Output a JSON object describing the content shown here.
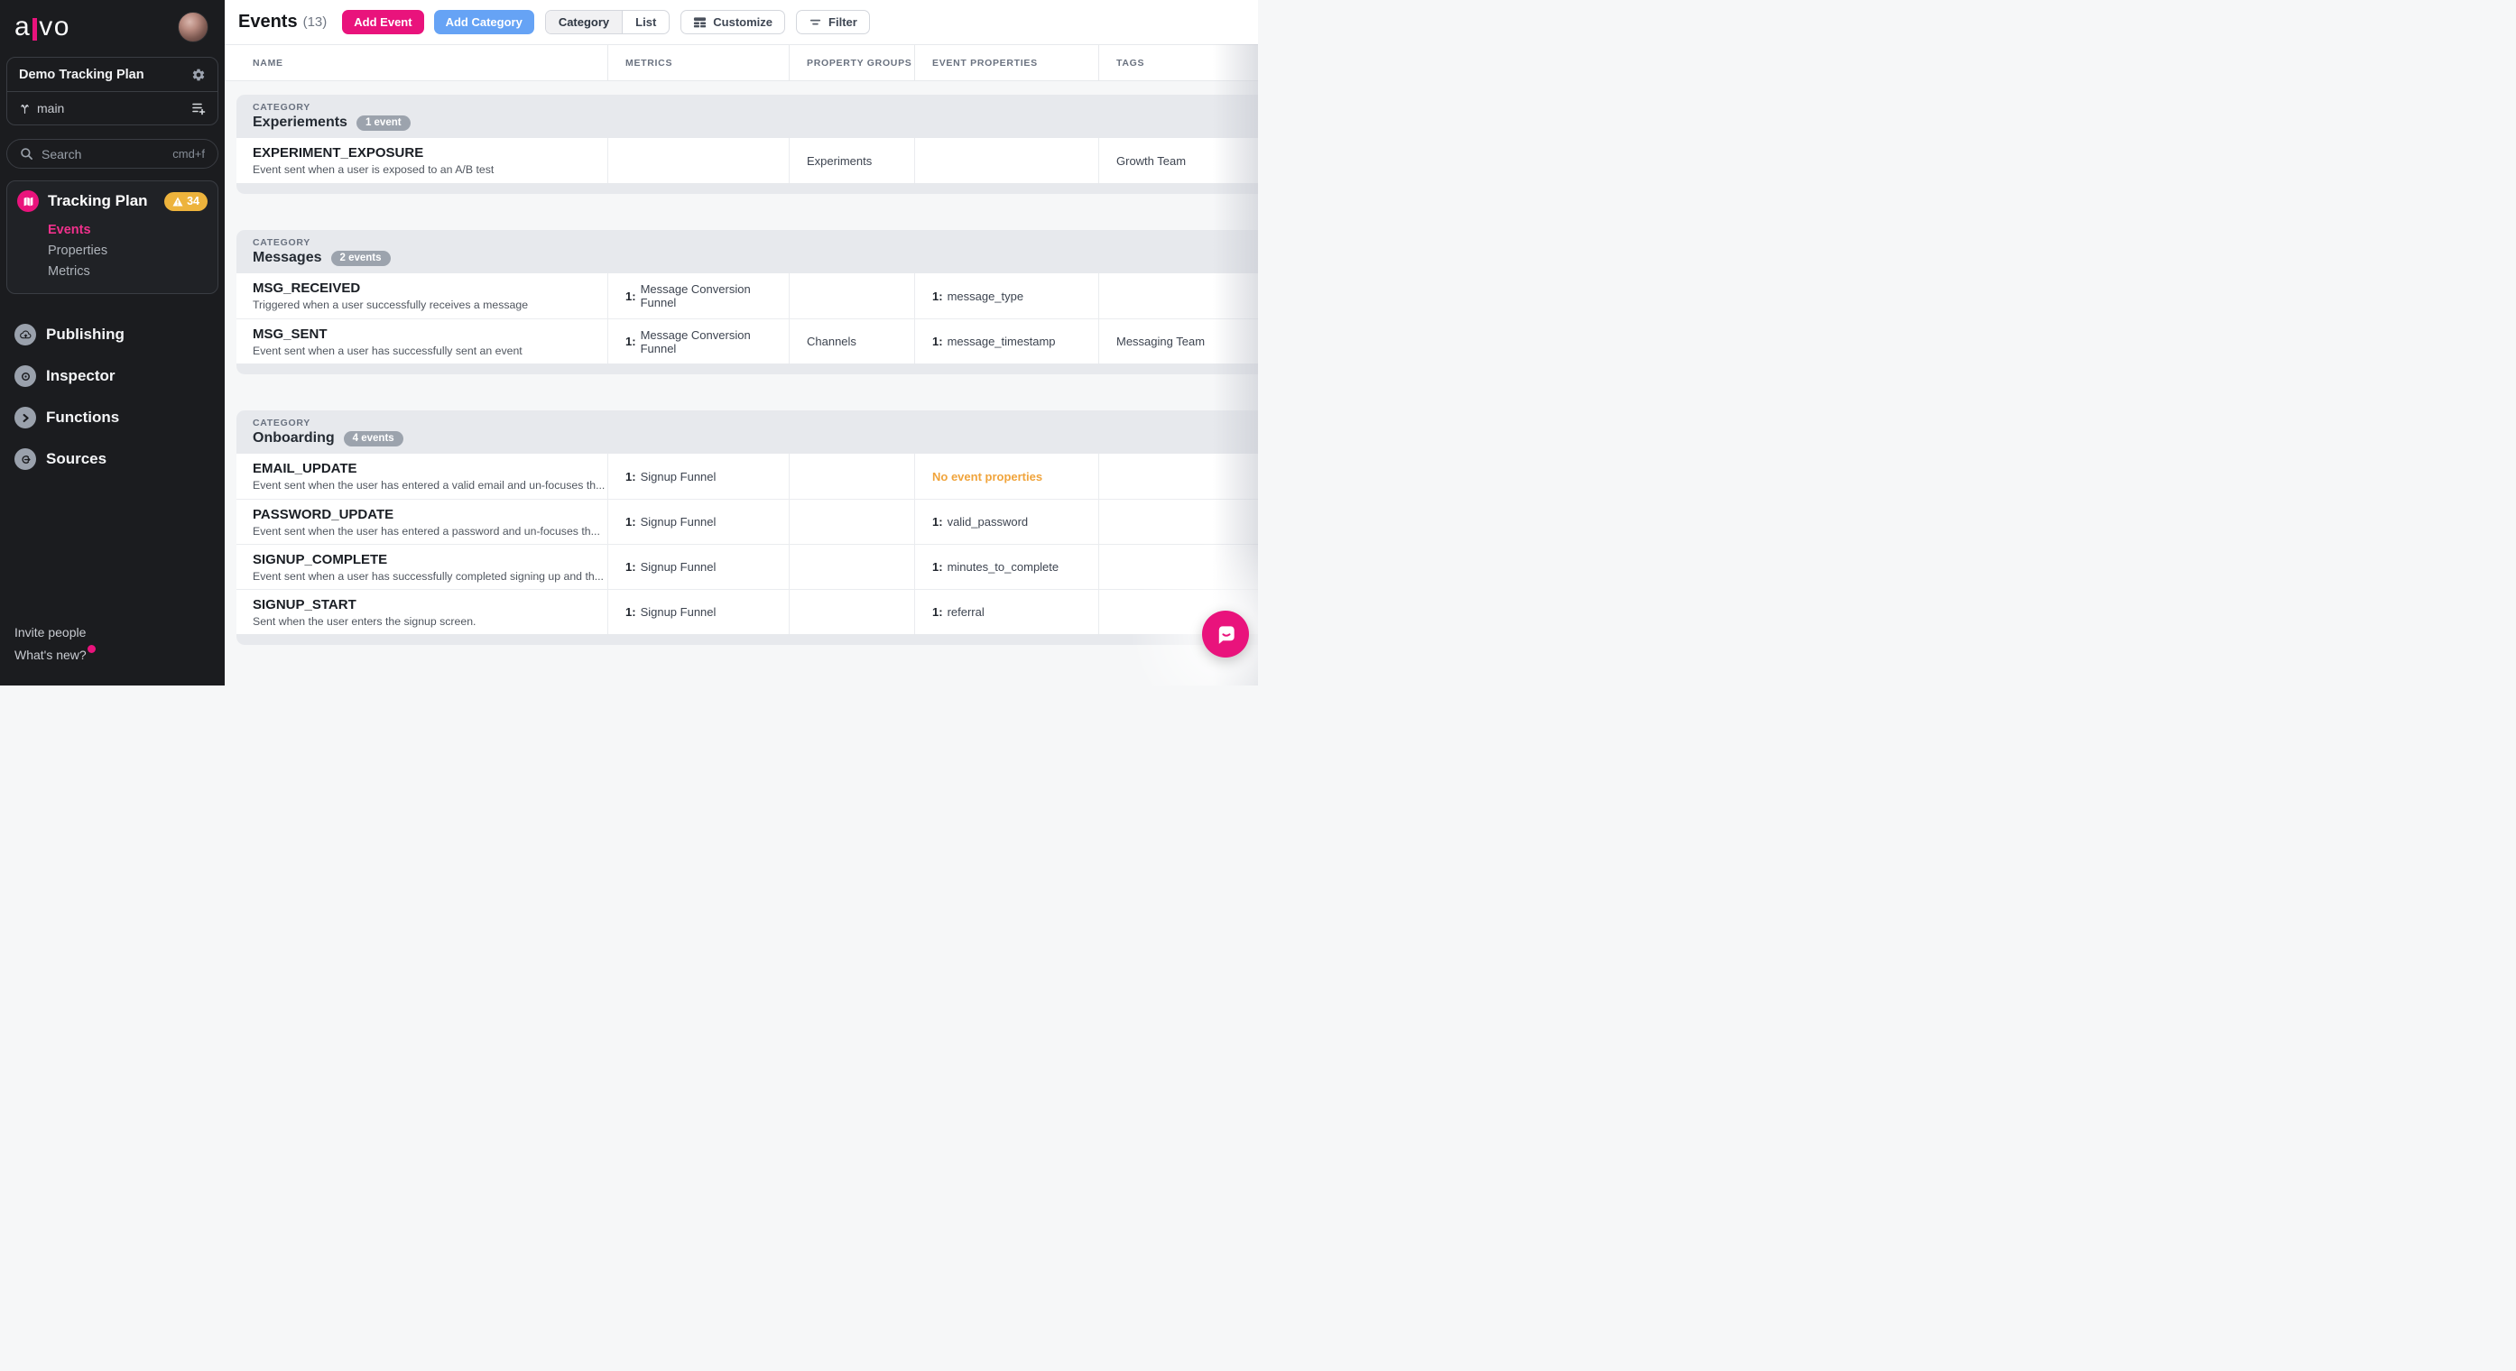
{
  "sidebar": {
    "logo_a": "a",
    "logo_vo": "vo",
    "workspace_name": "Demo Tracking Plan",
    "branch_name": "main",
    "search_placeholder": "Search",
    "search_shortcut": "cmd+f",
    "tracking_plan": {
      "label": "Tracking Plan",
      "warning_count": "34",
      "items": [
        {
          "label": "Events",
          "active": true
        },
        {
          "label": "Properties",
          "active": false
        },
        {
          "label": "Metrics",
          "active": false
        }
      ]
    },
    "nav": {
      "publishing": "Publishing",
      "inspector": "Inspector",
      "functions": "Functions",
      "sources": "Sources"
    },
    "invite_people": "Invite people",
    "whats_new": "What's new?"
  },
  "header": {
    "title": "Events",
    "count": "(13)",
    "add_event": "Add Event",
    "add_category": "Add Category",
    "view_category": "Category",
    "view_list": "List",
    "customize": "Customize",
    "filter": "Filter"
  },
  "table": {
    "category_label": "Category",
    "columns": [
      "Name",
      "Metrics",
      "Property Groups",
      "Event Properties",
      "Tags"
    ],
    "categories": [
      {
        "name": "Experiements",
        "badge": "1 event",
        "events": [
          {
            "name": "EXPERIMENT_EXPOSURE",
            "description": "Event sent when a user is exposed to an A/B test",
            "property_group": "Experiments",
            "tag": "Growth Team"
          }
        ]
      },
      {
        "name": "Messages",
        "badge": "2 events",
        "events": [
          {
            "name": "MSG_RECEIVED",
            "description": "Triggered when a user successfully receives a message",
            "metrics_count": "1:",
            "metrics_label": "Message Conversion Funnel",
            "ep_count": "1:",
            "ep_label": "message_type"
          },
          {
            "name": "MSG_SENT",
            "description": "Event sent when a user has successfully sent an event",
            "metrics_count": "1:",
            "metrics_label": "Message Conversion Funnel",
            "property_group": "Channels",
            "ep_count": "1:",
            "ep_label": "message_timestamp",
            "tag": "Messaging Team"
          }
        ]
      },
      {
        "name": "Onboarding",
        "badge": "4 events",
        "events": [
          {
            "name": "EMAIL_UPDATE",
            "description": "Event sent when the user has entered a valid email and un-focuses th...",
            "metrics_count": "1:",
            "metrics_label": "Signup Funnel",
            "ep_warning": "No event properties"
          },
          {
            "name": "PASSWORD_UPDATE",
            "description": "Event sent when the user has entered a password and un-focuses th...",
            "metrics_count": "1:",
            "metrics_label": "Signup Funnel",
            "ep_count": "1:",
            "ep_label": "valid_password"
          },
          {
            "name": "SIGNUP_COMPLETE",
            "description": "Event sent when a user has successfully completed signing up and th...",
            "metrics_count": "1:",
            "metrics_label": "Signup Funnel",
            "ep_count": "1:",
            "ep_label": "minutes_to_complete"
          },
          {
            "name": "SIGNUP_START",
            "description": "Sent when the user enters the signup screen.",
            "metrics_count": "1:",
            "metrics_label": "Signup Funnel",
            "ep_count": "1:",
            "ep_label": "referral"
          }
        ]
      }
    ]
  },
  "colors": {
    "accent_pink": "#E9137C",
    "accent_blue": "#66A3F5",
    "warning_badge_yellow": "#EDB33C",
    "warning_text_orange": "#F0A43C",
    "sidebar_bg": "#1B1C1F",
    "category_header_bg": "#E7E9ED"
  }
}
